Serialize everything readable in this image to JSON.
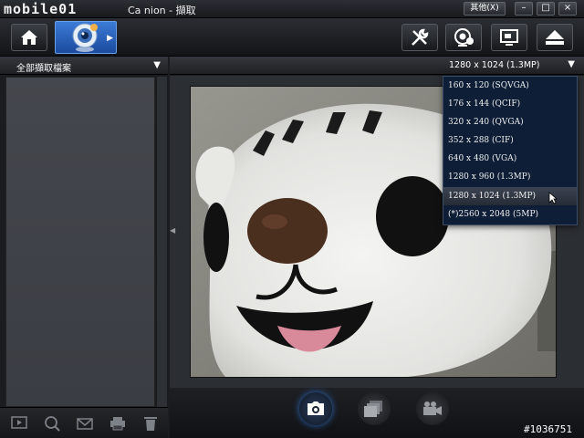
{
  "titlebar": {
    "logo": "mobile01",
    "title": "Ca            nion - 擷取",
    "other_button": "其他(X)",
    "minimize": "–",
    "maximize": "□",
    "close": "×"
  },
  "toolbar": {
    "home_icon": "home-icon",
    "webcam_icon": "webcam-icon",
    "settings_icon": "tools-icon",
    "effects_icon": "webcam-settings-icon",
    "screen_icon": "display-icon",
    "eject_icon": "eject-icon"
  },
  "left_panel": {
    "filter_label": "全部擷取檔案",
    "footer_icons": [
      "play-icon",
      "zoom-icon",
      "email-icon",
      "print-icon",
      "trash-icon"
    ]
  },
  "resolution": {
    "current": "1280 x 1024 (1.3MP)",
    "options": [
      "160 x 120 (SQVGA)",
      "176 x 144 (QCIF)",
      "320 x 240 (QVGA)",
      "352 x 288 (CIF)",
      "640 x 480 (VGA)",
      "1280 x 960 (1.3MP)",
      "1280 x 1024 (1.3MP)",
      "(*)2560 x 2048 (5MP)"
    ],
    "selected_index": 6
  },
  "capture": {
    "photo_icon": "camera-icon",
    "burst_icon": "burst-icon",
    "video_icon": "video-camera-icon"
  },
  "watermark": "#1036751",
  "colors": {
    "accent": "#2a6ad0",
    "dropdown_bg": "#0d1e36"
  }
}
